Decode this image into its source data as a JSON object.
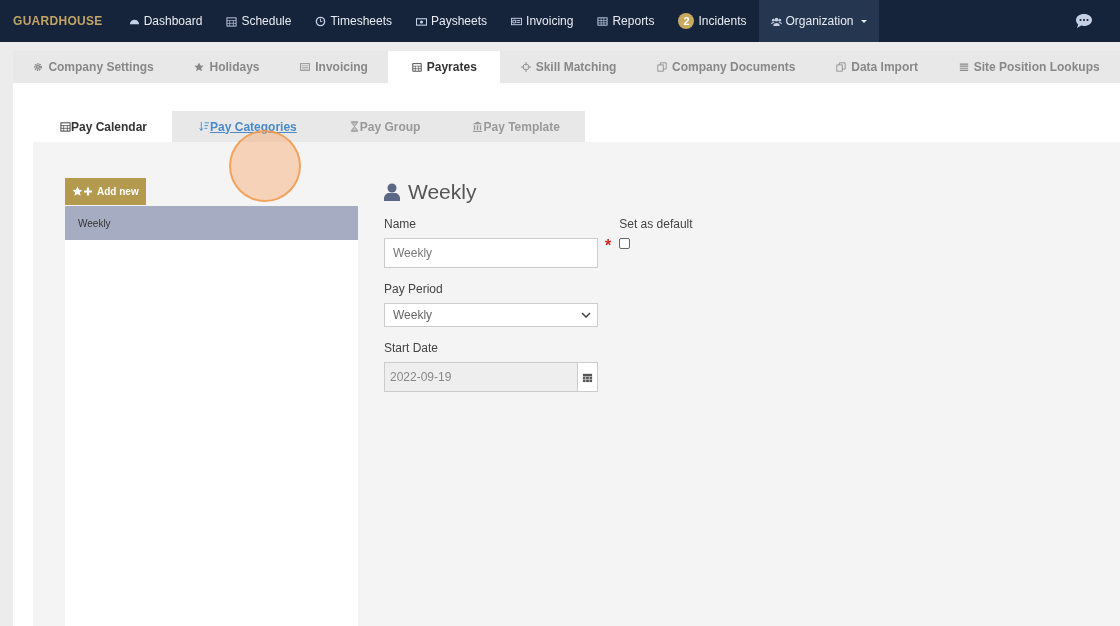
{
  "brand": "GUARDHOUSE",
  "nav": [
    {
      "label": "Dashboard",
      "selected": false
    },
    {
      "label": "Schedule",
      "selected": false
    },
    {
      "label": "Timesheets",
      "selected": false
    },
    {
      "label": "Paysheets",
      "selected": false
    },
    {
      "label": "Invoicing",
      "selected": false
    },
    {
      "label": "Reports",
      "selected": false
    },
    {
      "label": "Incidents",
      "badge": "2",
      "selected": false
    },
    {
      "label": "Organization",
      "selected": true,
      "dropdown": true
    }
  ],
  "tabs": [
    {
      "label": "Company Settings",
      "selected": false
    },
    {
      "label": "Holidays",
      "selected": false
    },
    {
      "label": "Invoicing",
      "selected": false
    },
    {
      "label": "Payrates",
      "selected": true
    },
    {
      "label": "Skill Matching",
      "selected": false
    },
    {
      "label": "Company Documents",
      "selected": false
    },
    {
      "label": "Data Import",
      "selected": false
    },
    {
      "label": "Site Position Lookups",
      "selected": false
    }
  ],
  "subtabs": [
    {
      "label": "Pay Calendar",
      "selected": true,
      "hovered": false
    },
    {
      "label": "Pay Categories",
      "selected": false,
      "hovered": true
    },
    {
      "label": "Pay Group",
      "selected": false,
      "hovered": false
    },
    {
      "label": "Pay Template",
      "selected": false,
      "hovered": false
    }
  ],
  "add_button": "Add new",
  "list": [
    {
      "label": "Weekly",
      "selected": true
    }
  ],
  "form": {
    "title": "Weekly",
    "name": {
      "label": "Name",
      "value": "Weekly",
      "required_mark": "*"
    },
    "default": {
      "label": "Set as default",
      "checked": false
    },
    "period": {
      "label": "Pay Period",
      "value": "Weekly"
    },
    "start": {
      "label": "Start Date",
      "value": "2022-09-19"
    }
  }
}
